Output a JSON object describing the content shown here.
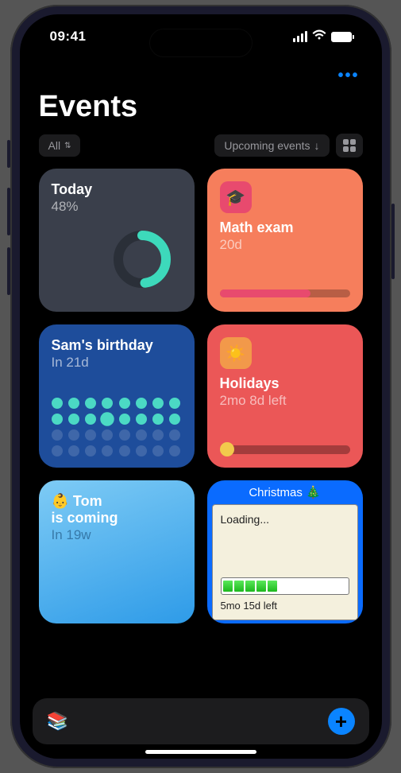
{
  "status": {
    "time": "09:41"
  },
  "header": {
    "title": "Events"
  },
  "controls": {
    "filter_label": "All",
    "sort_label": "Upcoming events"
  },
  "cards": {
    "today": {
      "title": "Today",
      "sub": "48%",
      "progress": 48
    },
    "math": {
      "title": "Math exam",
      "sub": "20d",
      "icon": "🎓",
      "bar_pct": 70,
      "bar_color": "#e84a6e"
    },
    "sam": {
      "title": "Sam's birthday",
      "sub": "In 21d"
    },
    "holidays": {
      "title": "Holidays",
      "sub": "2mo 8d left",
      "icon": "☀️"
    },
    "tom": {
      "title_line1": "👶 Tom",
      "title_line2": "is coming",
      "sub": "In 19w"
    },
    "xmas": {
      "header": "Christmas 🎄",
      "loading": "Loading...",
      "remaining": "5mo 15d left",
      "segments": 5
    }
  }
}
